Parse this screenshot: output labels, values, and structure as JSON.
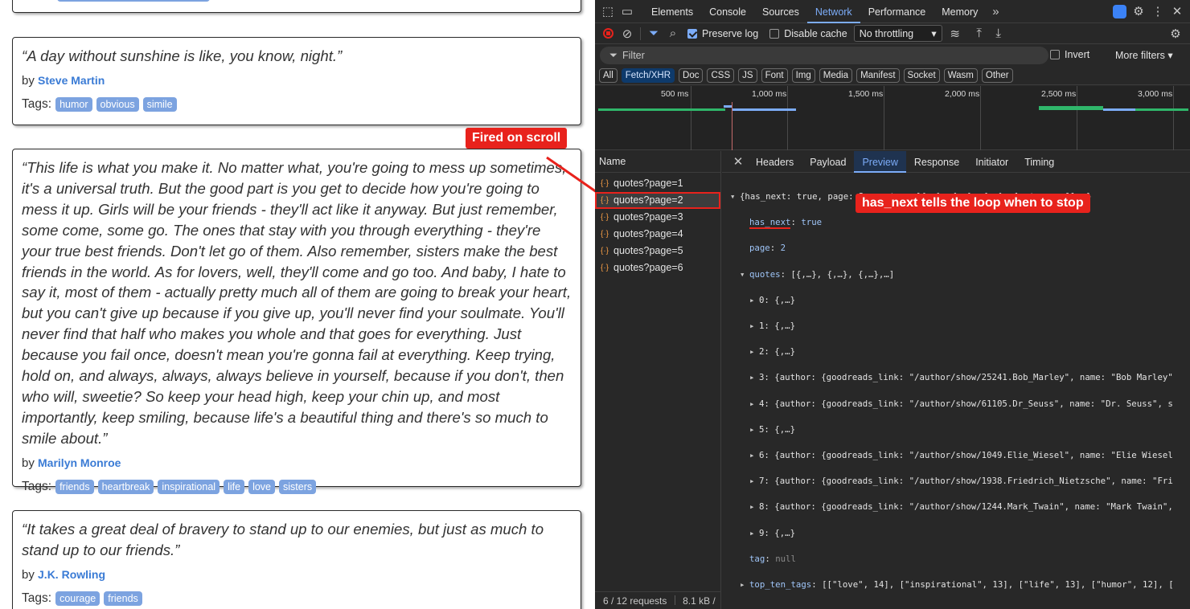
{
  "page": {
    "quotes": [
      {
        "text": "“A day without sunshine is like, you know, night.”",
        "by_label": "by",
        "author": "Steve Martin",
        "tags_label": "Tags:",
        "tags": [
          "humor",
          "obvious",
          "simile"
        ]
      },
      {
        "text": "“This life is what you make it. No matter what, you're going to mess up sometimes, it's a universal truth. But the good part is you get to decide how you're going to mess it up. Girls will be your friends - they'll act like it anyway. But just remember, some come, some go. The ones that stay with you through everything - they're your true best friends. Don't let go of them. Also remember, sisters make the best friends in the world. As for lovers, well, they'll come and go too. And baby, I hate to say it, most of them - actually pretty much all of them are going to break your heart, but you can't give up because if you give up, you'll never find your soulmate. You'll never find that half who makes you whole and that goes for everything. Just because you fail once, doesn't mean you're gonna fail at everything. Keep trying, hold on, and always, always, always believe in yourself, because if you don't, then who will, sweetie? So keep your head high, keep your chin up, and most importantly, keep smiling, because life's a beautiful thing and there's so much to smile about.”",
        "by_label": "by",
        "author": "Marilyn Monroe",
        "tags_label": "Tags:",
        "tags": [
          "friends",
          "heartbreak",
          "inspirational",
          "life",
          "love",
          "sisters"
        ]
      },
      {
        "text": "“It takes a great deal of bravery to stand up to our enemies, but just as much to stand up to our friends.”",
        "by_label": "by",
        "author": "J.K. Rowling",
        "tags_label": "Tags:",
        "tags": [
          "courage",
          "friends"
        ]
      }
    ],
    "callout_scroll": "Fired on scroll"
  },
  "devtools": {
    "panels": [
      "Elements",
      "Console",
      "Sources",
      "Network",
      "Performance",
      "Memory"
    ],
    "active_panel": "Network",
    "more_panels": "»",
    "toolbar": {
      "preserve_log": "Preserve log",
      "disable_cache": "Disable cache",
      "throttling": "No throttling"
    },
    "filter": {
      "placeholder": "Filter",
      "invert": "Invert",
      "more_filters": "More filters"
    },
    "type_chips": [
      "All",
      "Fetch/XHR",
      "Doc",
      "CSS",
      "JS",
      "Font",
      "Img",
      "Media",
      "Manifest",
      "Socket",
      "Wasm",
      "Other"
    ],
    "active_chip": "Fetch/XHR",
    "timeline_labels": [
      "500 ms",
      "1,000 ms",
      "1,500 ms",
      "2,000 ms",
      "2,500 ms",
      "3,000 ms"
    ],
    "name_header": "Name",
    "requests": [
      "quotes?page=1",
      "quotes?page=2",
      "quotes?page=3",
      "quotes?page=4",
      "quotes?page=5",
      "quotes?page=6"
    ],
    "selected_request": "quotes?page=2",
    "status": {
      "requests": "6 / 12 requests",
      "size": "8.1 kB /"
    },
    "detail_tabs": [
      "Headers",
      "Payload",
      "Preview",
      "Response",
      "Initiator",
      "Timing"
    ],
    "active_detail_tab": "Preview",
    "preview": {
      "root": "{has_next: true, page: 2, quotes: [{,…}, {,…}, {,…},…], tag: null,…}",
      "has_next_key": "has_next",
      "has_next_val": "true",
      "page_key": "page",
      "page_val": "2",
      "quotes_key": "quotes",
      "quotes_summary": "[{,…}, {,…}, {,…},…]",
      "items": [
        "0: {,…}",
        "1: {,…}",
        "2: {,…}",
        "3: {author: {goodreads_link: \"/author/show/25241.Bob_Marley\", name: \"Bob Marley\"",
        "4: {author: {goodreads_link: \"/author/show/61105.Dr_Seuss\", name: \"Dr. Seuss\", s",
        "5: {,…}",
        "6: {author: {goodreads_link: \"/author/show/1049.Elie_Wiesel\", name: \"Elie Wiesel",
        "7: {author: {goodreads_link: \"/author/show/1938.Friedrich_Nietzsche\", name: \"Fri",
        "8: {author: {goodreads_link: \"/author/show/1244.Mark_Twain\", name: \"Mark Twain\",",
        "9: {,…}"
      ],
      "tag_key": "tag",
      "tag_val": "null",
      "top_tags_key": "top_ten_tags",
      "top_tags_val": "[[\"love\", 14], [\"inspirational\", 13], [\"life\", 13], [\"humor\", 12], ["
    },
    "callout_has_next": "has_next tells the loop when to stop"
  },
  "colors": {
    "annotation_red": "#e8221c",
    "accent_blue": "#7cacf8",
    "tag_blue": "#7ca3e0",
    "author_blue": "#3a7bd5"
  }
}
